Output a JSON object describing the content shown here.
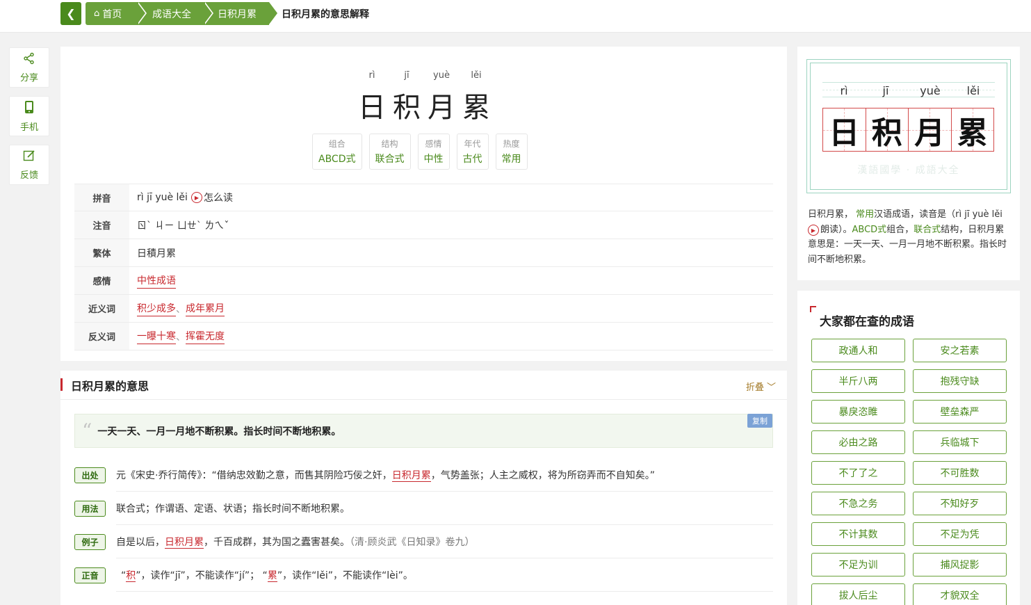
{
  "breadcrumb": {
    "back_icon": "chevron-left-icon",
    "home": "首页",
    "home_icon": "home-icon",
    "section": "成语大全",
    "idiom": "日积月累",
    "current": "日积月累的意思解释"
  },
  "tools": [
    {
      "label": "分享",
      "icon": "share-icon"
    },
    {
      "label": "手机",
      "icon": "phone-icon"
    },
    {
      "label": "反馈",
      "icon": "edit-icon"
    }
  ],
  "header": {
    "pinyin": [
      "rì",
      "jī",
      "yuè",
      "lěi"
    ],
    "chars": [
      "日",
      "积",
      "月",
      "累"
    ]
  },
  "attributes": [
    {
      "key": "组合",
      "value": "ABCD式"
    },
    {
      "key": "结构",
      "value": "联合式"
    },
    {
      "key": "感情",
      "value": "中性"
    },
    {
      "key": "年代",
      "value": "古代"
    },
    {
      "key": "热度",
      "value": "常用"
    }
  ],
  "info": {
    "pinyin_label": "拼音",
    "pinyin_value": "rì jī yuè lěi",
    "read_link": "怎么读",
    "zhuyin_label": "注音",
    "zhuyin_value": "ㄖˋ ㄐㄧ ㄩㄝˋ ㄌㄟˇ",
    "trad_label": "繁体",
    "trad_value": "日積月累",
    "emotion_label": "感情",
    "emotion_value": "中性成语",
    "synonym_label": "近义词",
    "synonyms": [
      "积少成多",
      "成年累月"
    ],
    "antonym_label": "反义词",
    "antonyms": [
      "一曝十寒",
      "挥霍无度"
    ],
    "separator": "、"
  },
  "meaning": {
    "title": "日积月累的意思",
    "fold": "折叠",
    "quote_mark": "“",
    "definition": "一天一天、一月一月地不断积累。指长时间不断地积累。",
    "copy": "复制",
    "origin_tag": "出处",
    "origin_pre": "元《宋史·乔行简传》：“借纳忠效勤之意，而售其阴险巧佞之奸，",
    "origin_hl": "日积月累",
    "origin_post": "，气势盖张；人主之威权，将为所窃弄而不自知矣。”",
    "usage_tag": "用法",
    "usage": "联合式；作谓语、定语、状语；指长时间不断地积累。",
    "example_tag": "例子",
    "example_pre": "自是以后，",
    "example_hl": "日积月累",
    "example_post": "，千百成群，其为国之蠹害甚矣。",
    "example_src": "（清·顾炎武《日知录》卷九）",
    "pron_tag": "正音",
    "pron_q1": "“",
    "pron_c1": "积",
    "pron_t1": "”，读作“jī”，不能读作“jí”；",
    "pron_q2": "“",
    "pron_c2": "累",
    "pron_t2": "”，读作“lěi”，不能读作“lèi”。"
  },
  "board": {
    "pinyin": [
      "rì",
      "jī",
      "yuè",
      "lěi"
    ],
    "chars": [
      "日",
      "积",
      "月",
      "累"
    ],
    "watermark": "漢語國學 · 成語大全"
  },
  "summary": {
    "p1": "日积月累，",
    "p2": "常用",
    "p3": "汉语成语，读音是（rì jī yuè lěi",
    "p4": "朗读）。",
    "p5": "ABCD式",
    "p6": "组合，",
    "p7": "联合式",
    "p8": "结构，日积月累意思是：一天一天、一月一月地不断积累。指长时间不断地积累。"
  },
  "popular": {
    "title": "大家都在查的成语",
    "items": [
      "政通人和",
      "安之若素",
      "半斤八两",
      "抱残守缺",
      "暴戾恣睢",
      "壁垒森严",
      "必由之路",
      "兵临城下",
      "不了了之",
      "不可胜数",
      "不急之务",
      "不知好歹",
      "不计其数",
      "不足为凭",
      "不足为训",
      "捕风捉影",
      "拔人后尘",
      "才貌双全"
    ]
  },
  "colors": {
    "green": "#4a8a1c",
    "red": "#c8282e"
  }
}
